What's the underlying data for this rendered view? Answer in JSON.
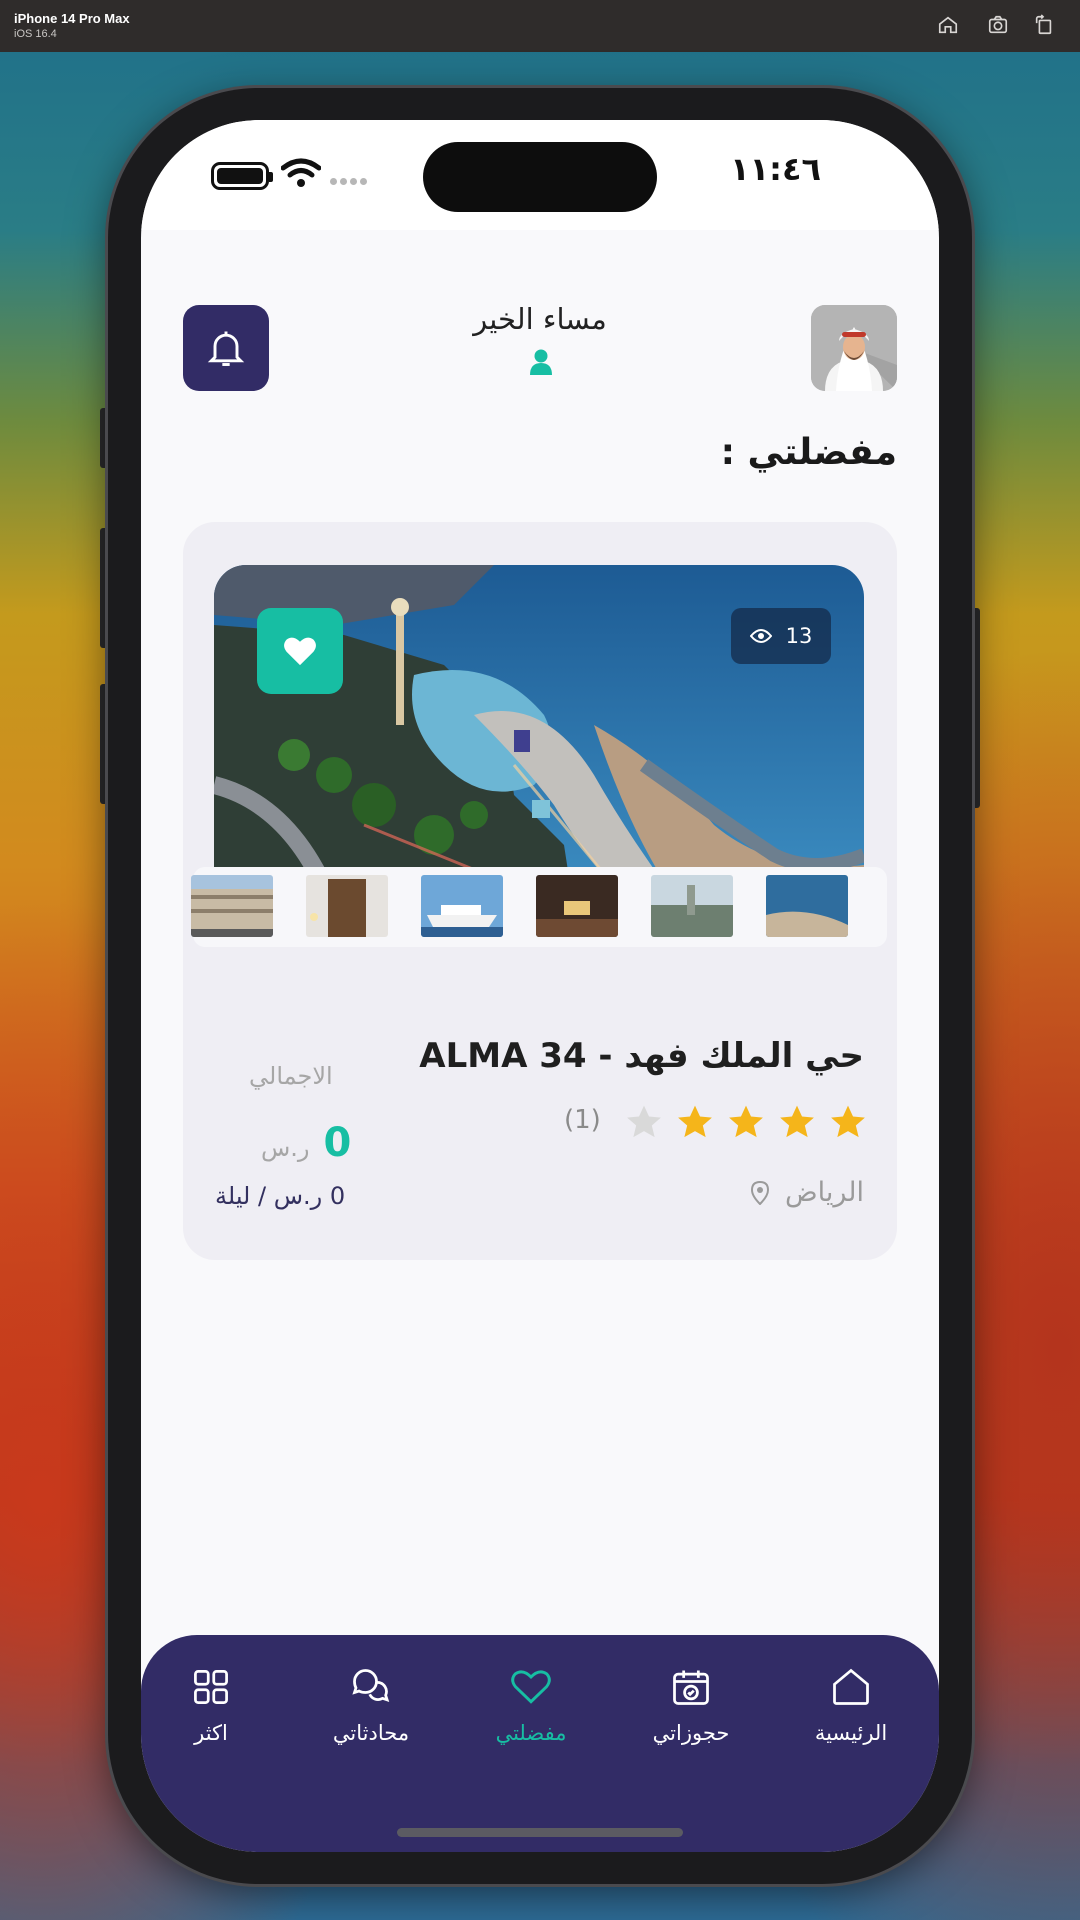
{
  "simulator": {
    "device": "iPhone 14 Pro Max",
    "os": "iOS 16.4",
    "icons": [
      "home-icon",
      "screenshot-icon",
      "rotate-icon"
    ]
  },
  "status_bar": {
    "time": "١١:٤٦"
  },
  "header": {
    "greeting": "مساء الخير",
    "notification_icon": "bell-icon",
    "user_icon": "person-icon"
  },
  "section_title": "مفضلتي :",
  "listing": {
    "title": "ALMA 34 - حي الملك فهد",
    "views": "13",
    "rating_stars": 4,
    "rating_max": 5,
    "rating_count": "(1)",
    "location": "الرياض",
    "total_label": "الاجمالي",
    "price": "0",
    "price_unit": "ر.س",
    "per_night": "0 ر.س / ليلة",
    "favorite": true,
    "thumbnails_count": 6
  },
  "nav": {
    "items": [
      {
        "label": "الرئيسية",
        "icon": "home-icon"
      },
      {
        "label": "حجوزاتي",
        "icon": "calendar-check-icon"
      },
      {
        "label": "مفضلتي",
        "icon": "heart-icon"
      },
      {
        "label": "محادثاتي",
        "icon": "chat-icon"
      },
      {
        "label": "اكثر",
        "icon": "grid-icon"
      }
    ],
    "active_index": 2
  },
  "colors": {
    "primary": "#322c66",
    "accent": "#17bea3",
    "star": "#f5b51a"
  }
}
